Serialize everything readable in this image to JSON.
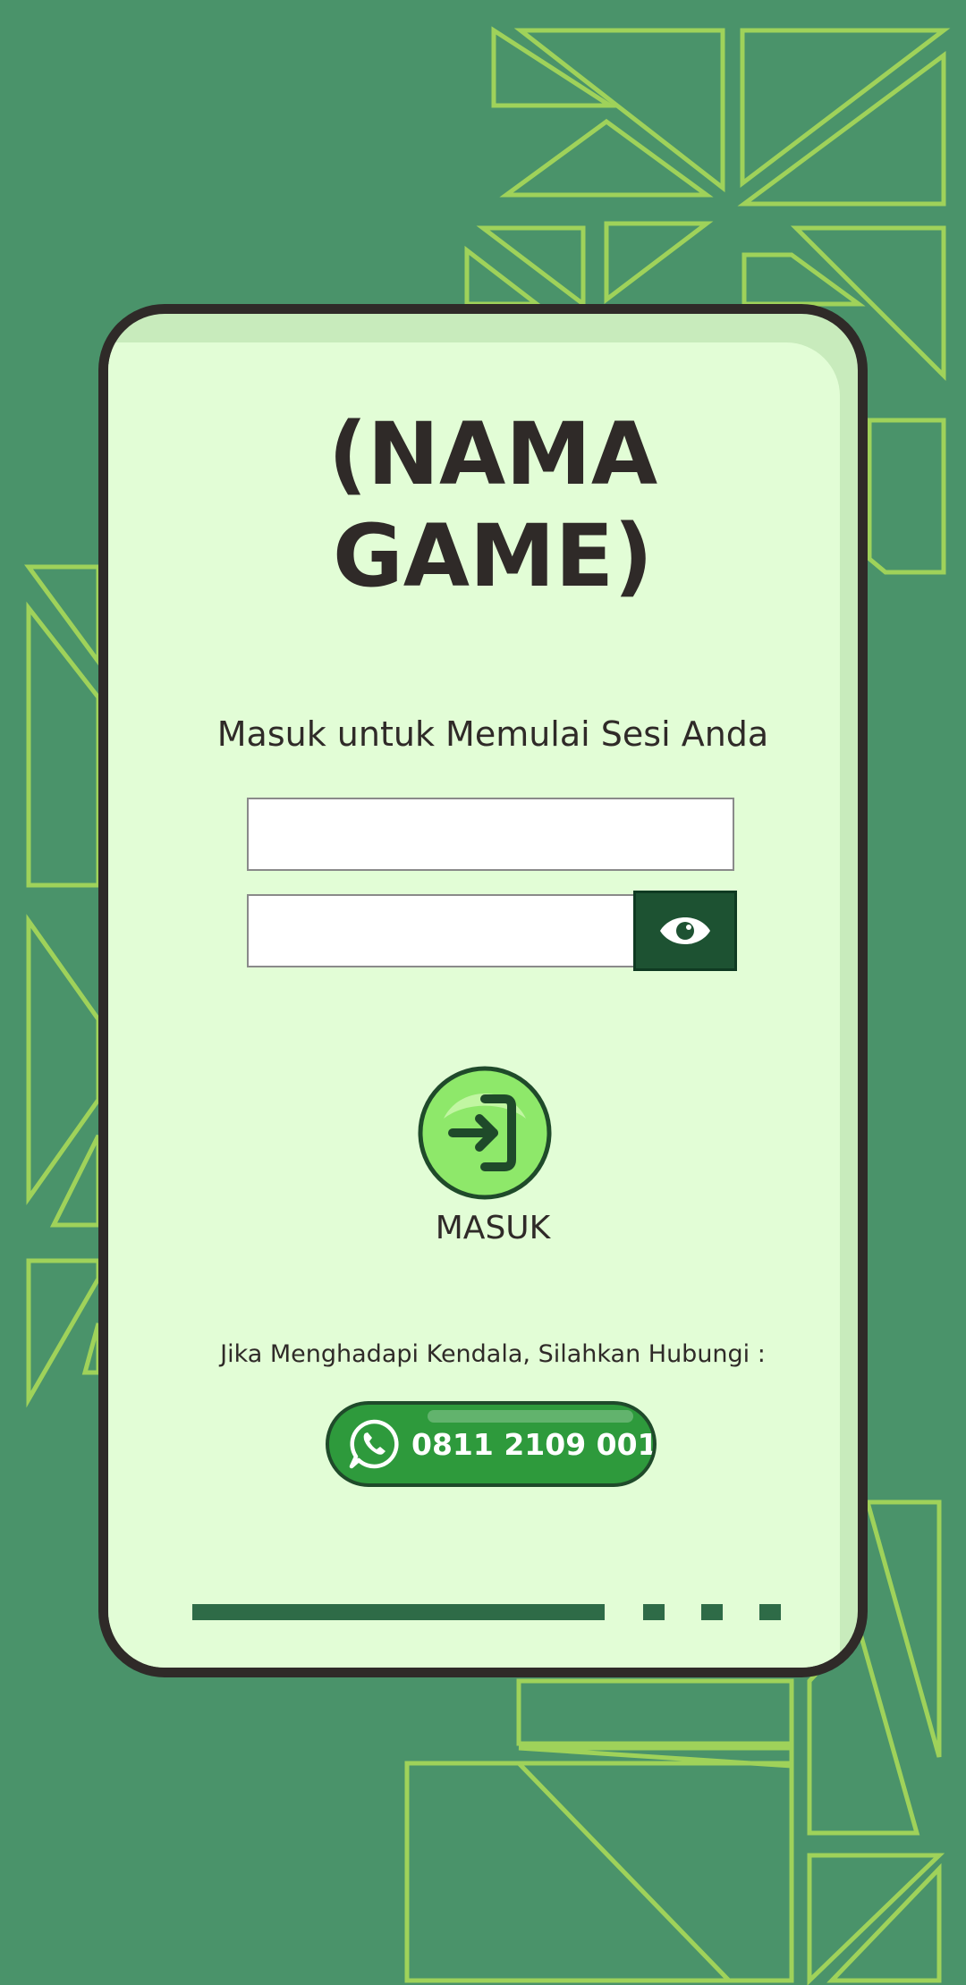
{
  "title": {
    "line1": "(NAMA",
    "line2": "GAME)"
  },
  "subtitle": "Masuk untuk Memulai Sesi Anda",
  "username": {
    "value": "",
    "placeholder": ""
  },
  "password": {
    "value": "",
    "placeholder": ""
  },
  "toggle_password_icon": "eye-icon",
  "login_button": {
    "label": "MASUK",
    "icon": "login-arrow-icon"
  },
  "help_text": "Jika Menghadapi Kendala, Silahkan Hubungi :",
  "whatsapp_button": {
    "number": "0811 2109 001",
    "icon": "whatsapp-icon"
  },
  "colors": {
    "background": "#4a936a",
    "pattern_stroke": "#9fd25a",
    "card_fill": "#e2fdd6",
    "card_border": "#2f2a28",
    "accent_dark": "#1d5232",
    "button_green": "#2e9a3c",
    "login_green": "#8ee86a"
  }
}
